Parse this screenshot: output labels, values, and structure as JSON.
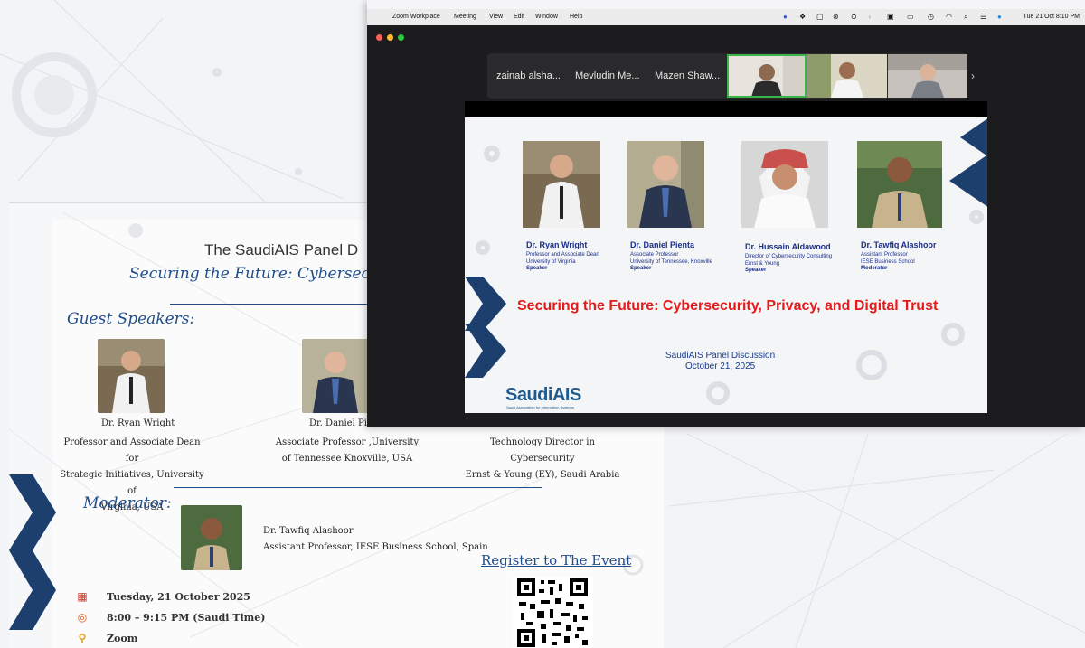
{
  "menubar": {
    "app_name": "Zoom Workplace",
    "menus": [
      "Meeting",
      "View",
      "Edit",
      "Window",
      "Help"
    ],
    "clock": "Tue 21 Oct  8:10 PM"
  },
  "gallery": {
    "participants": [
      "zainab alsha...",
      "Mevludin Me...",
      "Mazen Shaw..."
    ],
    "more_glyph": "›"
  },
  "slide": {
    "speakers": [
      {
        "name": "Dr. Ryan Wright",
        "lines": [
          "Professor and Associate Dean",
          "University of Virginia"
        ],
        "role": "Speaker"
      },
      {
        "name": "Dr. Daniel Pienta",
        "lines": [
          "Associate Professor",
          "University of Tennessee, Knoxville"
        ],
        "role": "Speaker"
      },
      {
        "name": "Dr. Hussain Aldawood",
        "lines": [
          "Director of Cybersecurity Consulting",
          "Ernst & Young"
        ],
        "role": "Speaker"
      },
      {
        "name": "Dr. Tawfiq Alashoor",
        "lines": [
          "Assistant Professor",
          "IESE Business School"
        ],
        "role": "Moderator"
      }
    ],
    "title": "Securing the Future: Cybersecurity, Privacy, and Digital Trust",
    "subtitle_line1": "SaudiAIS Panel Discussion",
    "subtitle_line2": "October 21, 2025",
    "logo_text": "SaudiAIS",
    "logo_tagline": "Saudi Association for Information Systems"
  },
  "flyer": {
    "title": "The SaudiAIS Panel D",
    "subtitle": "Securing the Future: Cybersecurity, Pr",
    "guest_speakers_heading": "Guest Speakers:",
    "speakers": [
      {
        "name": "Dr. Ryan Wright",
        "desc": [
          "Professor and Associate Dean for",
          "Strategic Initiatives,  University of",
          "Virginia, USA"
        ]
      },
      {
        "name": "Dr. Daniel Pienta",
        "desc": [
          "Associate Professor ,University",
          "of Tennessee Knoxville, USA"
        ]
      },
      {
        "name": "Dr. Hussain Aldawood",
        "desc": [
          "Technology Director in Cybersecurity",
          "Ernst & Young (EY), Saudi Arabia"
        ]
      }
    ],
    "moderator_heading": "Moderator:",
    "moderator": {
      "name": "Dr. Tawfiq Alashoor",
      "desc": "Assistant Professor, IESE Business School, Spain"
    },
    "date": "Tuesday, 21 October 2025",
    "time": "8:00 – 9:15 PM (Saudi Time)",
    "platform": "Zoom",
    "register_label": "Register to The Event"
  },
  "colors": {
    "brand_blue": "#1f4e8c",
    "slide_title_red": "#e31b1b",
    "speaker_blue": "#1a2f8a",
    "active_speaker_border": "#3bb54a",
    "chevron_navy": "#1d3f6e"
  }
}
